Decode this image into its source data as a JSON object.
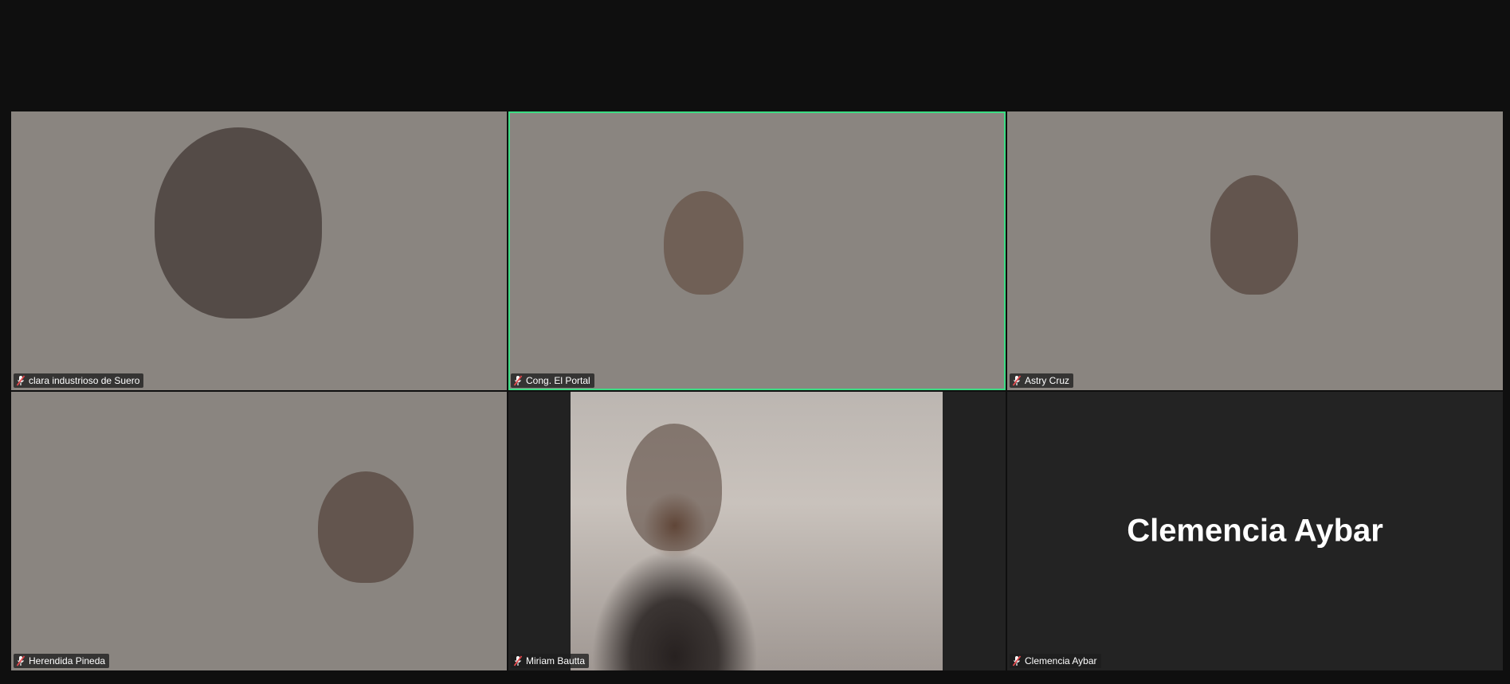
{
  "participants": [
    {
      "name": "clara industrioso de Suero",
      "muted": true,
      "video": true
    },
    {
      "name": "Cong. El Portal",
      "muted": true,
      "video": true,
      "active_speaker": true
    },
    {
      "name": "Astry Cruz",
      "muted": true,
      "video": true
    },
    {
      "name": "Herendida Pineda",
      "muted": true,
      "video": true
    },
    {
      "name": "Miriam Bautta",
      "muted": true,
      "video": true
    },
    {
      "name": "Clemencia Aybar",
      "muted": true,
      "video": false
    }
  ],
  "colors": {
    "active_border": "#3ddc84",
    "muted_icon": "#e5484d",
    "tile_background": "#232323"
  },
  "icons": {
    "muted": "muted-microphone-icon"
  }
}
